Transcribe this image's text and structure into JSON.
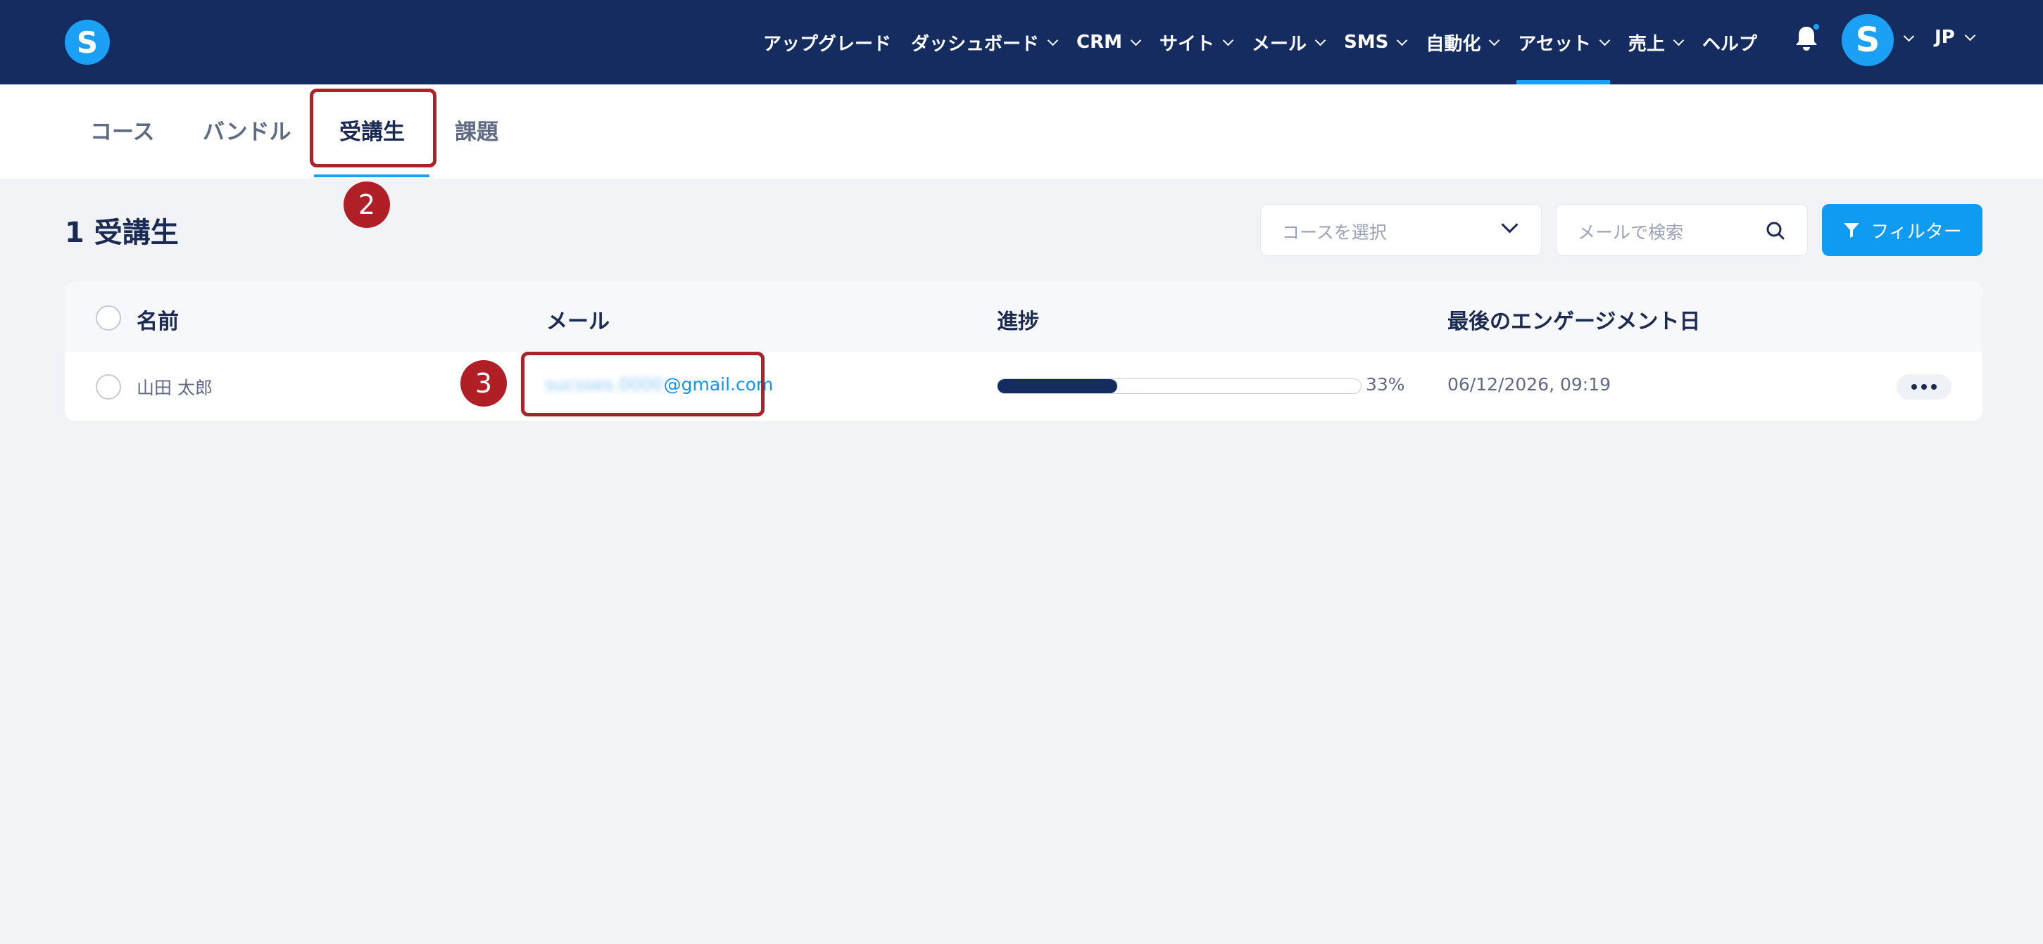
{
  "brand": {
    "logo_letter": "S"
  },
  "nav": {
    "items": [
      {
        "label": "アップグレード",
        "dropdown": false
      },
      {
        "label": "ダッシュボード",
        "dropdown": true
      },
      {
        "label": "CRM",
        "dropdown": true
      },
      {
        "label": "サイト",
        "dropdown": true
      },
      {
        "label": "メール",
        "dropdown": true
      },
      {
        "label": "SMS",
        "dropdown": true
      },
      {
        "label": "自動化",
        "dropdown": true
      },
      {
        "label": "アセット",
        "dropdown": true,
        "active": true
      },
      {
        "label": "売上",
        "dropdown": true
      },
      {
        "label": "ヘルプ",
        "dropdown": false
      }
    ],
    "avatar_letter": "S",
    "language": "JP",
    "notification_icon": "bell-icon"
  },
  "tabs": [
    {
      "label": "コース"
    },
    {
      "label": "バンドル"
    },
    {
      "label": "受講生",
      "active": true
    },
    {
      "label": "課題"
    }
  ],
  "annotations": {
    "step_tab": "2",
    "step_email": "3"
  },
  "toolbar": {
    "count_title": "1 受講生",
    "course_select_placeholder": "コースを選択",
    "search_placeholder": "メールで検索",
    "filter_label": "フィルター"
  },
  "table": {
    "columns": {
      "name": "名前",
      "email": "メール",
      "progress": "進捗",
      "last_engagement": "最後のエンゲージメント日"
    },
    "rows": [
      {
        "name": "山田 太郎",
        "email_hidden": "sucsses.0000",
        "email_domain": "@gmail.com",
        "progress_percent": 33,
        "progress_label": "33%",
        "last_engagement": "06/12/2026, 09:19"
      }
    ]
  },
  "colors": {
    "topbar": "#142c60",
    "accent": "#1aa0f5",
    "annotation": "#a8232a",
    "background": "#f1f3f7"
  }
}
